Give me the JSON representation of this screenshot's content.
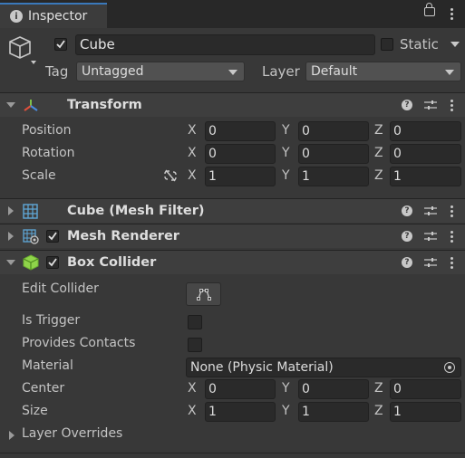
{
  "tab": {
    "title": "Inspector"
  },
  "object": {
    "name": "Cube",
    "active": true,
    "static_label": "Static"
  },
  "tag": {
    "label": "Tag",
    "value": "Untagged"
  },
  "layer": {
    "label": "Layer",
    "value": "Default"
  },
  "transform": {
    "title": "Transform",
    "rows": [
      {
        "label": "Position",
        "x": "0",
        "y": "0",
        "z": "0"
      },
      {
        "label": "Rotation",
        "x": "0",
        "y": "0",
        "z": "0"
      },
      {
        "label": "Scale",
        "x": "1",
        "y": "1",
        "z": "1"
      }
    ]
  },
  "axes": {
    "x": "X",
    "y": "Y",
    "z": "Z"
  },
  "mesh_filter": {
    "title": "Cube (Mesh Filter)"
  },
  "mesh_renderer": {
    "title": "Mesh Renderer",
    "enabled": true
  },
  "box_collider": {
    "title": "Box Collider",
    "enabled": true,
    "edit_collider_label": "Edit Collider",
    "is_trigger_label": "Is Trigger",
    "is_trigger": false,
    "provides_contacts_label": "Provides Contacts",
    "provides_contacts": false,
    "material_label": "Material",
    "material_value": "None (Physic Material)",
    "center": {
      "label": "Center",
      "x": "0",
      "y": "0",
      "z": "0"
    },
    "size": {
      "label": "Size",
      "x": "1",
      "y": "1",
      "z": "1"
    },
    "layer_overrides_label": "Layer Overrides"
  },
  "colors": {
    "accent": "#3a79bb",
    "background": "#383838",
    "header": "#3e3e3e"
  }
}
